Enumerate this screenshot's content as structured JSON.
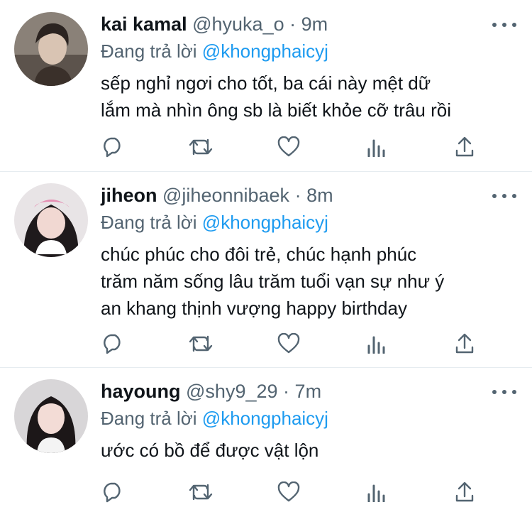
{
  "tweets": [
    {
      "name": "kai kamal",
      "handle": "@hyuka_o",
      "sep": "·",
      "time": "9m",
      "replying_prefix": "Đang trả lời",
      "mention": "@khongphaicyj",
      "lines": [
        "sếp nghỉ ngơi cho tốt, ba cái này mệt dữ",
        "lắm mà nhìn ông sb là biết khỏe cỡ trâu rồi"
      ]
    },
    {
      "name": "jiheon",
      "handle": "@jiheonnibaek",
      "sep": "·",
      "time": "8m",
      "replying_prefix": "Đang trả lời",
      "mention": "@khongphaicyj",
      "lines": [
        "chúc phúc cho đôi trẻ, chúc hạnh phúc",
        "trăm năm sống lâu trăm tuổi vạn sự như ý",
        "an khang thịnh vượng happy birthday"
      ]
    },
    {
      "name": "hayoung",
      "handle": "@shy9_29",
      "sep": "·",
      "time": "7m",
      "replying_prefix": "Đang trả lời",
      "mention": "@khongphaicyj",
      "lines": [
        "ước có bồ để được vật lộn"
      ]
    }
  ],
  "icons": [
    "reply-icon",
    "retweet-icon",
    "like-icon",
    "views-icon",
    "share-icon",
    "more-icon"
  ],
  "colors": {
    "text": "#0f1419",
    "secondary": "#536471",
    "mention": "#1d9bf0",
    "divider": "#e6ecf0"
  }
}
